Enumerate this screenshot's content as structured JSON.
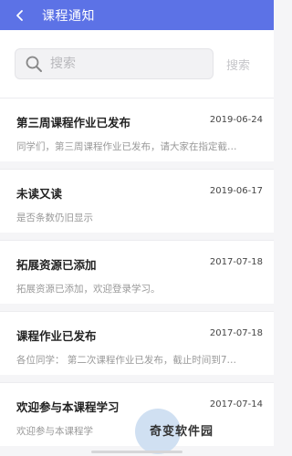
{
  "header": {
    "title": "课程通知",
    "back_icon": "chevron-left-icon"
  },
  "search": {
    "placeholder": "搜索",
    "button_label": "搜索",
    "icon": "search-icon"
  },
  "notifications": [
    {
      "title": "第三周课程作业已发布",
      "date": "2019-06-24",
      "preview": "同学们，第三周课程作业已发布，请大家在指定截…"
    },
    {
      "title": "未读又读",
      "date": "2019-06-17",
      "preview": "是否条数仍旧显示"
    },
    {
      "title": "拓展资源已添加",
      "date": "2017-07-18",
      "preview": "拓展资源已添加，欢迎登录学习。"
    },
    {
      "title": "课程作业已发布",
      "date": "2017-07-18",
      "preview": "各位同学：   第二次课程作业已发布，截止时间到7…"
    },
    {
      "title": "欢迎参与本课程学习",
      "date": "2017-07-14",
      "preview": "欢迎参与本课程学"
    }
  ],
  "watermark": {
    "text": "奇变软件园"
  },
  "colors": {
    "header_bg": "#5c72e6",
    "page_bg": "#f5f5f7"
  }
}
